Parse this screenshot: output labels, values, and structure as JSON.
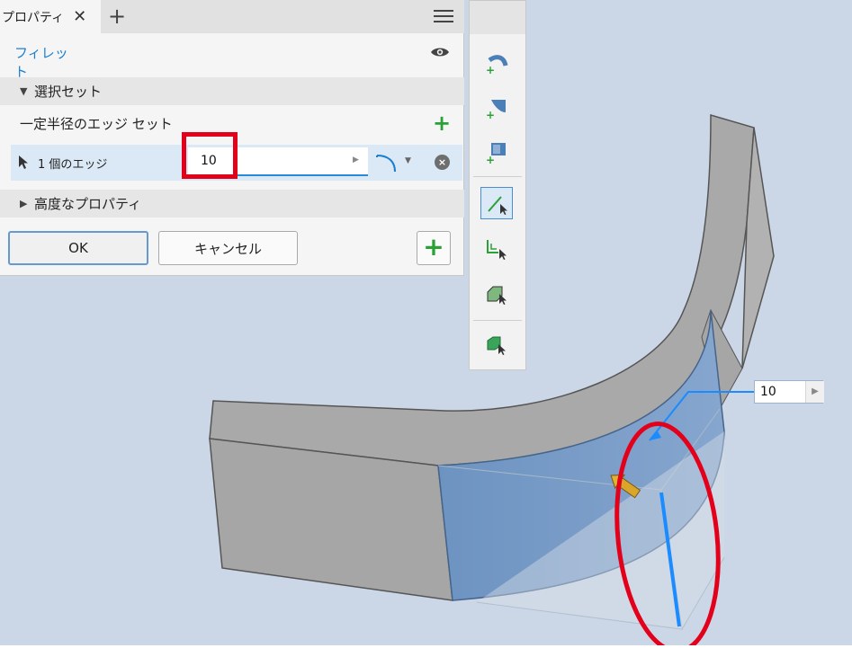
{
  "panel": {
    "tab_title": "プロパティ",
    "close_glyph": "✕",
    "add_tab_glyph": "+",
    "feature_name": "フィレット",
    "section_selection": "選択セット",
    "set_name": "一定半径のエッジ セット",
    "edge_count_label": "1 個のエッジ",
    "radius_value": "10",
    "remove_glyph": "×",
    "section_advanced": "高度なプロパティ",
    "ok_label": "OK",
    "cancel_label": "キャンセル",
    "add_set_glyph": "+",
    "add_edge_glyph": "+"
  },
  "viewport": {
    "radius_readout": "10"
  },
  "icons": {
    "tab_menu": "hamburger-menu-icon",
    "visibility": "eye-icon",
    "selector": "cursor-arrow-icon",
    "shape": "fillet-shape-icon"
  },
  "colors": {
    "accent_blue": "#1a7fd1",
    "add_green": "#2aa136",
    "highlight_red": "#e2001a",
    "selected_face": "#7a9fc9",
    "edge_highlight": "#1a8cff"
  }
}
